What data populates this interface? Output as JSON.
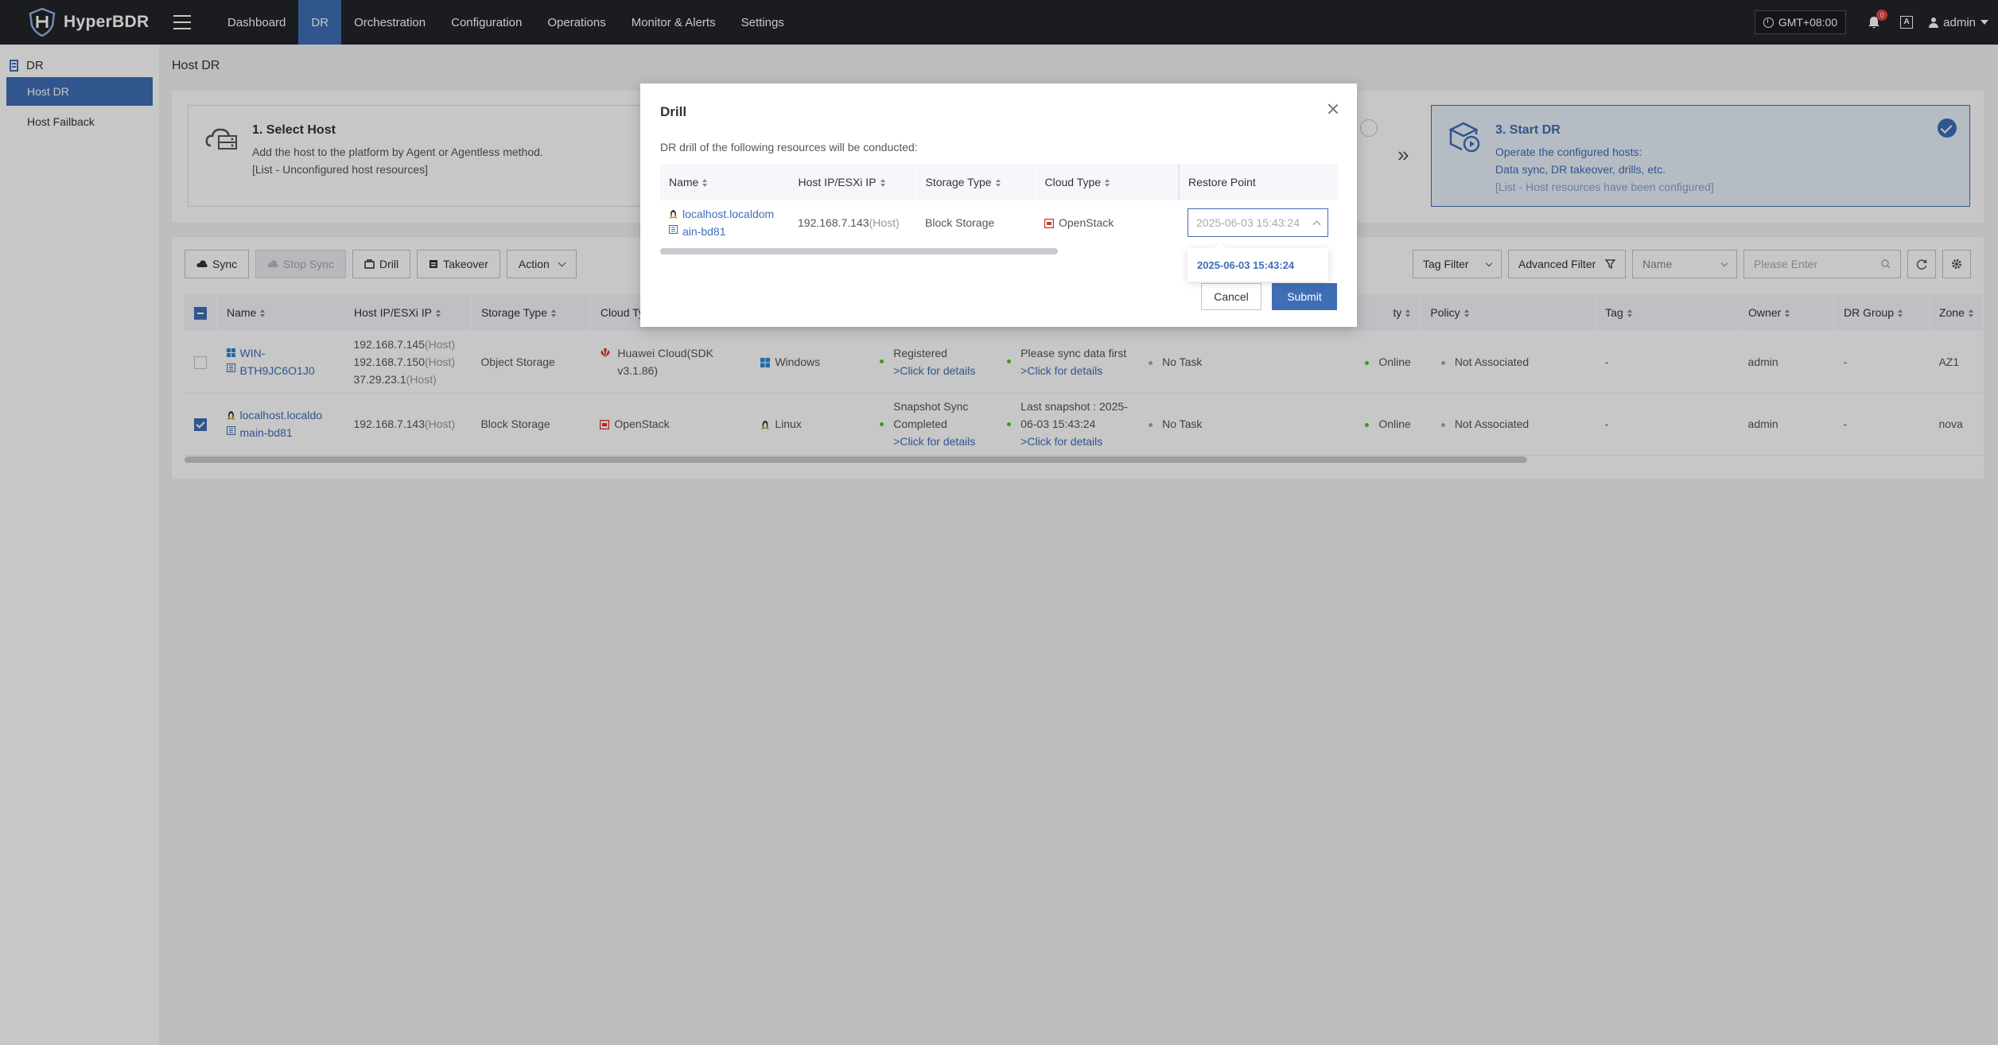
{
  "app": {
    "logo_text": "HyperBDR"
  },
  "nav": [
    "Dashboard",
    "DR",
    "Orchestration",
    "Configuration",
    "Operations",
    "Monitor & Alerts",
    "Settings"
  ],
  "topbar": {
    "timezone": "GMT+08:00",
    "notifications": "0",
    "lang": "A",
    "user": "admin"
  },
  "sidebar": {
    "section": "DR",
    "items": [
      "Host DR",
      "Host Failback"
    ]
  },
  "breadcrumb": "Host DR",
  "steps": {
    "step1": {
      "title": "1. Select Host",
      "line1": "Add the host to the platform by Agent or Agentless method.",
      "line2": "[List - Unconfigured host resources]"
    },
    "step3": {
      "title": "3. Start DR",
      "line1": "Operate the configured hosts:",
      "line2": "Data sync, DR takeover, drills, etc.",
      "line3": "[List - Host resources have been configured]"
    }
  },
  "toolbar": {
    "sync": "Sync",
    "stop_sync": "Stop Sync",
    "drill": "Drill",
    "takeover": "Takeover",
    "action": "Action"
  },
  "filters": {
    "tag": "Tag Filter",
    "advanced": "Advanced Filter",
    "field": "Name",
    "search_placeholder": "Please Enter"
  },
  "table": {
    "headers": [
      "Name",
      "Host IP/ESXi IP",
      "Storage Type",
      "Cloud Typ",
      "",
      "",
      "",
      "",
      "ty",
      "Policy",
      "Tag",
      "Owner",
      "DR Group",
      "Zone"
    ],
    "rows": [
      {
        "name1": "WIN-",
        "name2": "BTH9JC6O1J0",
        "ips": [
          "192.168.7.145",
          "192.168.7.150",
          "37.29.23.1"
        ],
        "ip_suffix": "(Host)",
        "storage": "Object Storage",
        "cloud1": "Huawei Cloud(SDK",
        "cloud2": "v3.1.86)",
        "os": "Windows",
        "reg1": "Registered",
        "reg2": ">Click for details",
        "sync1": "Please sync data first",
        "sync2": ">Click for details",
        "task": "No Task",
        "status": "Online",
        "policy": "Not Associated",
        "tag": "-",
        "owner": "admin",
        "group": "-",
        "zone": "AZ1",
        "checked": false
      },
      {
        "name1": "localhost.localdo",
        "name2": "main-bd81",
        "ips": [
          "192.168.7.143"
        ],
        "ip_suffix": "(Host)",
        "storage": "Block Storage",
        "cloud1": "OpenStack",
        "cloud2": "",
        "os": "Linux",
        "reg1": "Snapshot Sync",
        "reg1b": "Completed",
        "reg2": ">Click for details",
        "sync1": "Last snapshot : 2025-",
        "sync1b": "06-03 15:43:24",
        "sync2": ">Click for details",
        "task": "No Task",
        "status": "Online",
        "policy": "Not Associated",
        "tag": "-",
        "owner": "admin",
        "group": "-",
        "zone": "nova",
        "checked": true
      }
    ]
  },
  "modal": {
    "title": "Drill",
    "desc": "DR drill of the following resources will be conducted:",
    "headers": [
      "Name",
      "Host IP/ESXi IP",
      "Storage Type",
      "Cloud Type",
      "Restore Point"
    ],
    "row": {
      "name1": "localhost.localdom",
      "name2": "ain-bd81",
      "ip": "192.168.7.143",
      "ip_suffix": "(Host)",
      "storage": "Block Storage",
      "cloud": "OpenStack",
      "restore_placeholder": "2025-06-03 15:43:24"
    },
    "option": "2025-06-03 15:43:24",
    "cancel": "Cancel",
    "submit": "Submit"
  },
  "colors": {
    "accent": "#3f6eb5",
    "topbar": "#22242a",
    "online": "#52c41a"
  }
}
